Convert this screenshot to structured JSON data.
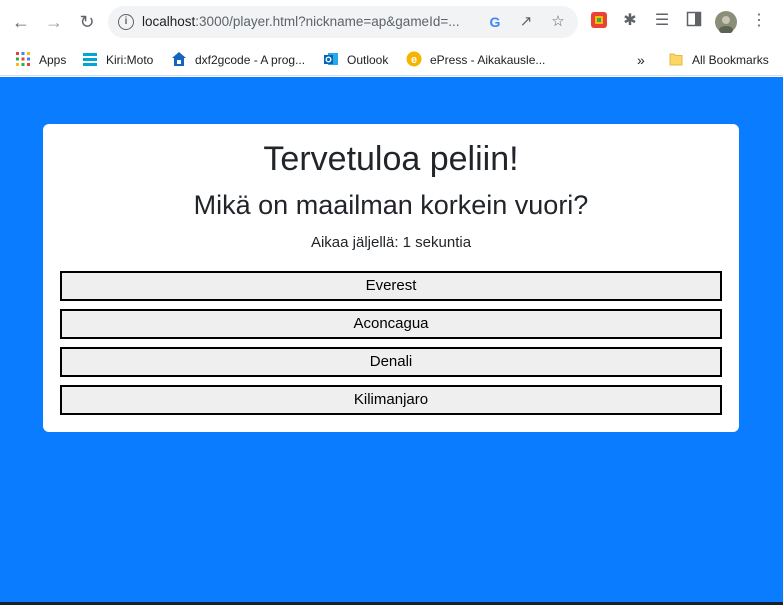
{
  "browser": {
    "url_host": "localhost",
    "url_rest": ":3000/player.html?nickname=ap&gameId=..."
  },
  "bookmarks": [
    {
      "label": "Apps"
    },
    {
      "label": "Kiri:Moto"
    },
    {
      "label": "dxf2gcode - A prog..."
    },
    {
      "label": "Outlook"
    },
    {
      "label": "ePress - Aikakausle..."
    }
  ],
  "bookmarks_overflow": "»",
  "all_bookmarks": "All Bookmarks",
  "game": {
    "title": "Tervetuloa peliin!",
    "question": "Mikä on maailman korkein vuori?",
    "timer": "Aikaa jäljellä: 1 sekuntia",
    "answers": [
      "Everest",
      "Aconcagua",
      "Denali",
      "Kilimanjaro"
    ]
  },
  "colors": {
    "page_background": "#0a7cff",
    "card_background": "#ffffff"
  }
}
